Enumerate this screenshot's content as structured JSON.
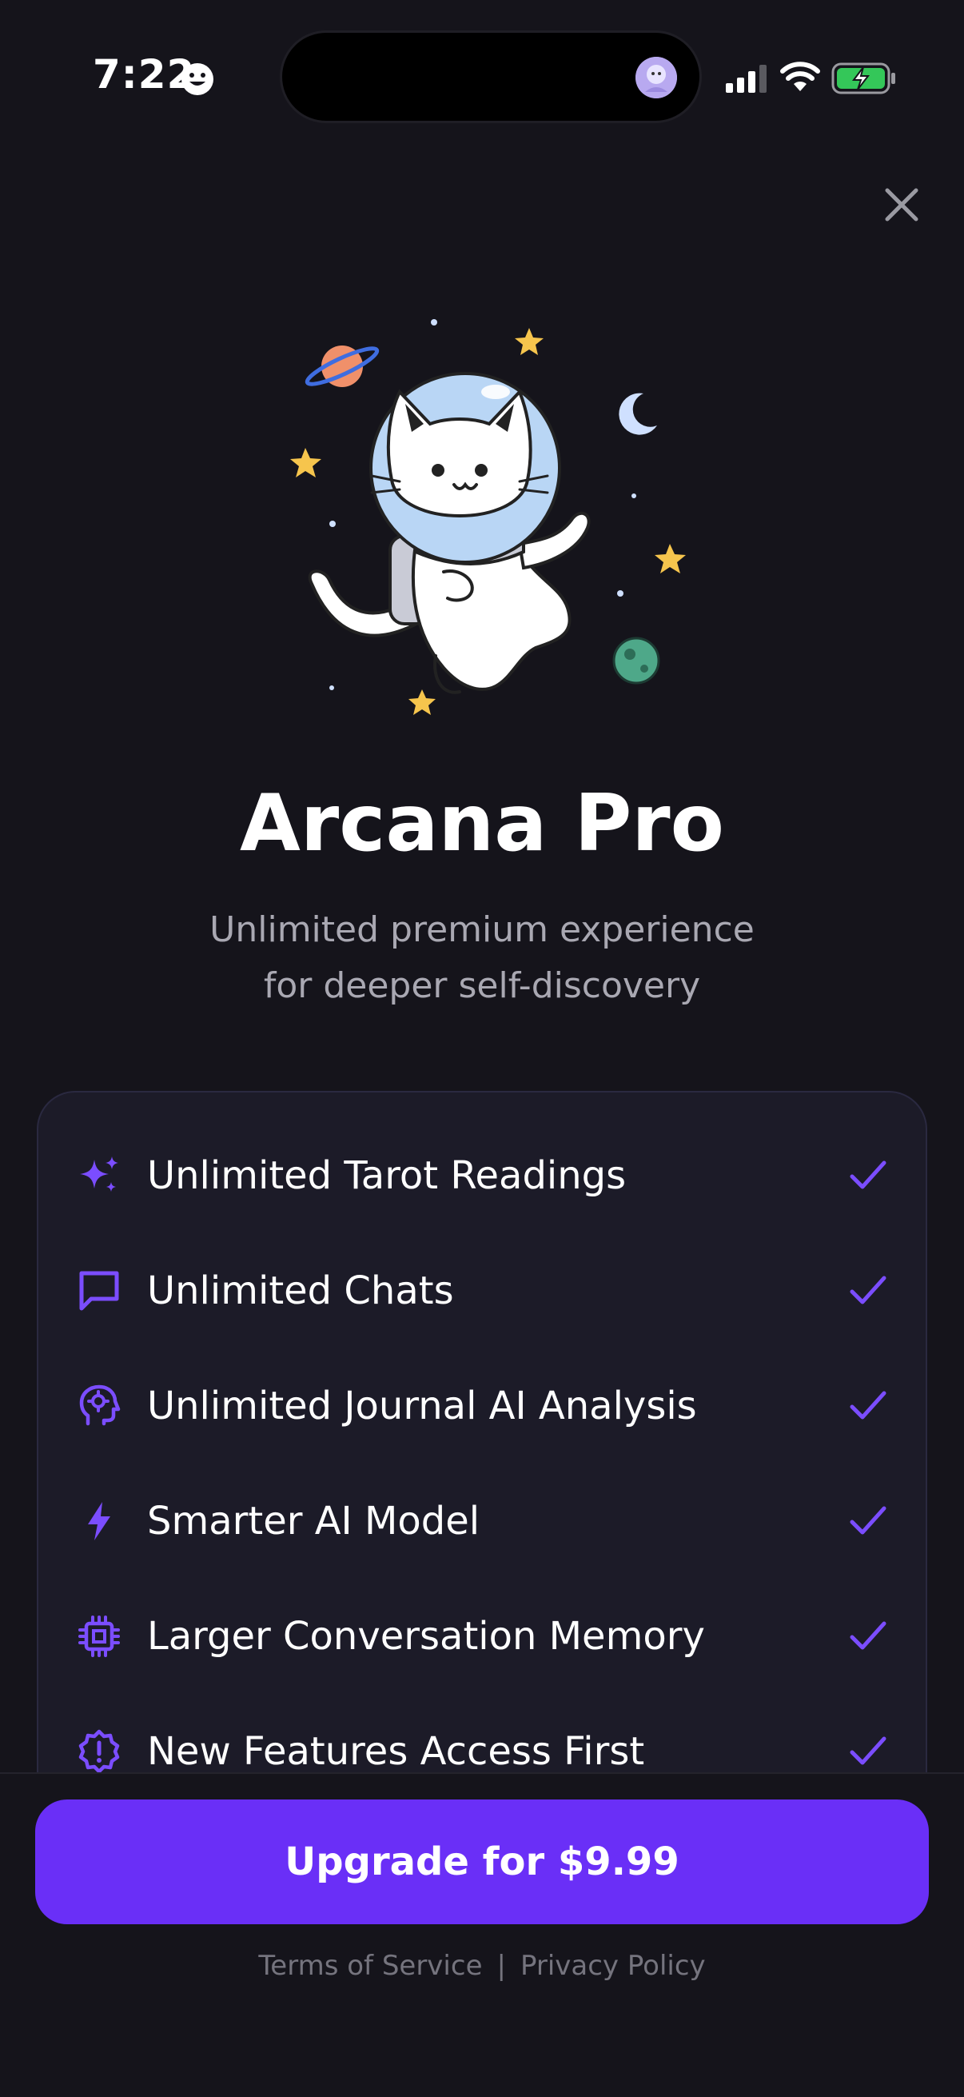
{
  "status_bar": {
    "time": "7:22"
  },
  "paywall": {
    "title": "Arcana Pro",
    "subtitle_line1": "Unlimited premium experience",
    "subtitle_line2": "for deeper self-discovery"
  },
  "features": [
    {
      "label": "Unlimited Tarot Readings",
      "icon": "sparkles-icon"
    },
    {
      "label": "Unlimited Chats",
      "icon": "chat-bubble-icon"
    },
    {
      "label": "Unlimited Journal AI Analysis",
      "icon": "brain-head-icon"
    },
    {
      "label": "Smarter AI Model",
      "icon": "lightning-icon"
    },
    {
      "label": "Larger Conversation Memory",
      "icon": "cpu-chip-icon"
    },
    {
      "label": "New Features Access First",
      "icon": "badge-alert-icon"
    }
  ],
  "cta": {
    "upgrade_label": "Upgrade for $9.99"
  },
  "legal": {
    "terms": "Terms of Service",
    "separator": "|",
    "privacy": "Privacy Policy"
  },
  "colors": {
    "background": "#15141b",
    "card": "#1c1b28",
    "accent": "#6a2ff7",
    "icon_accent": "#7b4dff",
    "muted_text": "#a9a8b2"
  }
}
